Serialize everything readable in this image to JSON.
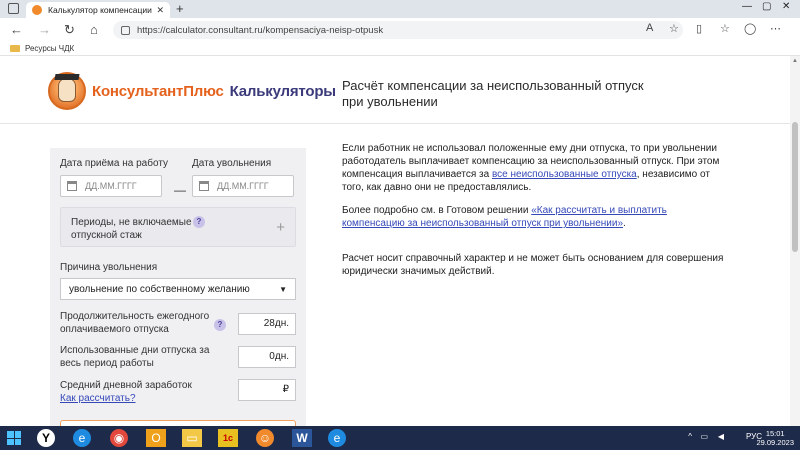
{
  "browser": {
    "tab_title": "Калькулятор компенсации за н",
    "tab_close": "✕",
    "new_tab": "+",
    "url": "https://calculator.consultant.ru/kompensaciya-neisp-otpusk",
    "favorites": [
      {
        "label": "Ресурсы ЧДК"
      }
    ],
    "icons": {
      "back": "←",
      "forward": "→",
      "refresh": "↻",
      "home": "⌂"
    }
  },
  "header": {
    "brand_part1": "КонсультантПлюс",
    "brand_part2": "Калькуляторы",
    "title": "Расчёт компенсации за неиспользованный отпуск при увольнении"
  },
  "form": {
    "hire_date_label": "Дата приёма на работу",
    "dismissal_date_label": "Дата увольнения",
    "date_placeholder": "ДД.ММ.ГГГГ",
    "dash": "—",
    "periods_label": "Периоды, не включаемые в отпускной стаж",
    "help": "?",
    "plus": "+",
    "reason_label": "Причина увольнения",
    "reason_value": "увольнение по собственному желанию",
    "reason_arrow": "▼",
    "leave_duration_label": "Продолжительность ежегодного оплачиваемого отпуска",
    "leave_duration_value": "28",
    "leave_duration_unit": "дн.",
    "used_days_label": "Использованные дни отпуска за весь период работы",
    "used_days_value": "0",
    "used_days_unit": "дн.",
    "avg_earnings_label": "Средний дневной заработок",
    "how_to_calc_link": "Как рассчитать?",
    "currency": "₽"
  },
  "info": {
    "p1_text": "Если работник не использовал положенные ему дни отпуска, то при увольнении работодатель выплачивает компенсацию за неиспользованный отпуск. При этом компенсация выплачивается за ",
    "p1_link": "все неиспользованные отпуска",
    "p1_tail": ", независимо от того, как давно они не предоставлялись.",
    "p2_text": "Более подробно см. в Готовом решении ",
    "p2_link": "«Как рассчитать и выплатить компенсацию за неиспользованный отпуск при увольнении»",
    "p2_tail": ".",
    "p3_text": "Расчет носит справочный характер и не может быть основанием для совершения юридически значимых действий."
  },
  "taskbar": {
    "language": "РУС",
    "time": "15:01",
    "date": "29.09.2023"
  }
}
